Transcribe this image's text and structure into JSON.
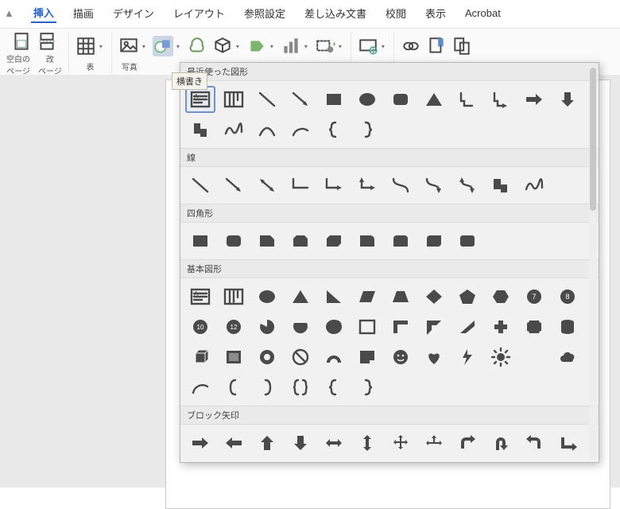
{
  "app": {
    "tabs": [
      "挿入",
      "描画",
      "デザイン",
      "レイアウト",
      "参照設定",
      "差し込み文書",
      "校閲",
      "表示",
      "Acrobat"
    ],
    "active_tab_index": 0,
    "partial_left": ""
  },
  "ribbon": {
    "blank_page": "空白の\nページ",
    "page_break": "改\nページ",
    "table": "表",
    "pictures": "写真"
  },
  "tooltip": "横書き",
  "panel": {
    "sections": {
      "recent": "最近使った図形",
      "lines": "線",
      "rects": "四角形",
      "basic": "基本図形",
      "block": "ブロック矢印"
    }
  },
  "shapes": {
    "recent": [
      "text-box-h",
      "text-box-v",
      "line",
      "line-arrow",
      "rect",
      "oval",
      "round-rect",
      "triangle",
      "l-shape",
      "l-arrow-shape",
      "arrow-right",
      "arrow-down",
      "l-shape-2",
      "scribble",
      "curve",
      "arc",
      "brace-left",
      "brace-right"
    ],
    "lines": [
      "line",
      "line-arrow",
      "line-double-arrow",
      "elbow",
      "elbow-arrow",
      "elbow-double",
      "curve-conn",
      "curve-arrow",
      "curve-double",
      "freeform",
      "scribble"
    ],
    "rects": [
      "rect",
      "round-rect",
      "snip1",
      "snip2",
      "snip-diag",
      "round1",
      "round2",
      "round-diag",
      "round-all"
    ],
    "basic": [
      "text-box-h",
      "text-box-v",
      "oval",
      "triangle",
      "right-triangle",
      "parallelogram",
      "trapezoid",
      "diamond",
      "pentagon",
      "hexagon",
      "heptagon",
      "octagon",
      "decagon",
      "dodecagon",
      "pie",
      "chord",
      "teardrop",
      "frame",
      "half-frame",
      "corner",
      "diag-stripe",
      "cross",
      "plaque",
      "can",
      "cube",
      "bevel",
      "donut",
      "no-symbol",
      "block-arc",
      "folded-corner",
      "smiley",
      "heart",
      "lightning",
      "sun",
      "moon",
      "cloud",
      "arc-line",
      "bracket-l",
      "bracket-r",
      "brace-pair",
      "brace-left",
      "brace-right"
    ],
    "block": [
      "arrow-right",
      "arrow-left",
      "arrow-up",
      "arrow-down",
      "arrow-lr",
      "arrow-ud",
      "arrow-quad",
      "arrow-tri",
      "arrow-bend-r",
      "arrow-uturn",
      "arrow-bend-l",
      "arrow-corner"
    ]
  },
  "chart_data": null
}
